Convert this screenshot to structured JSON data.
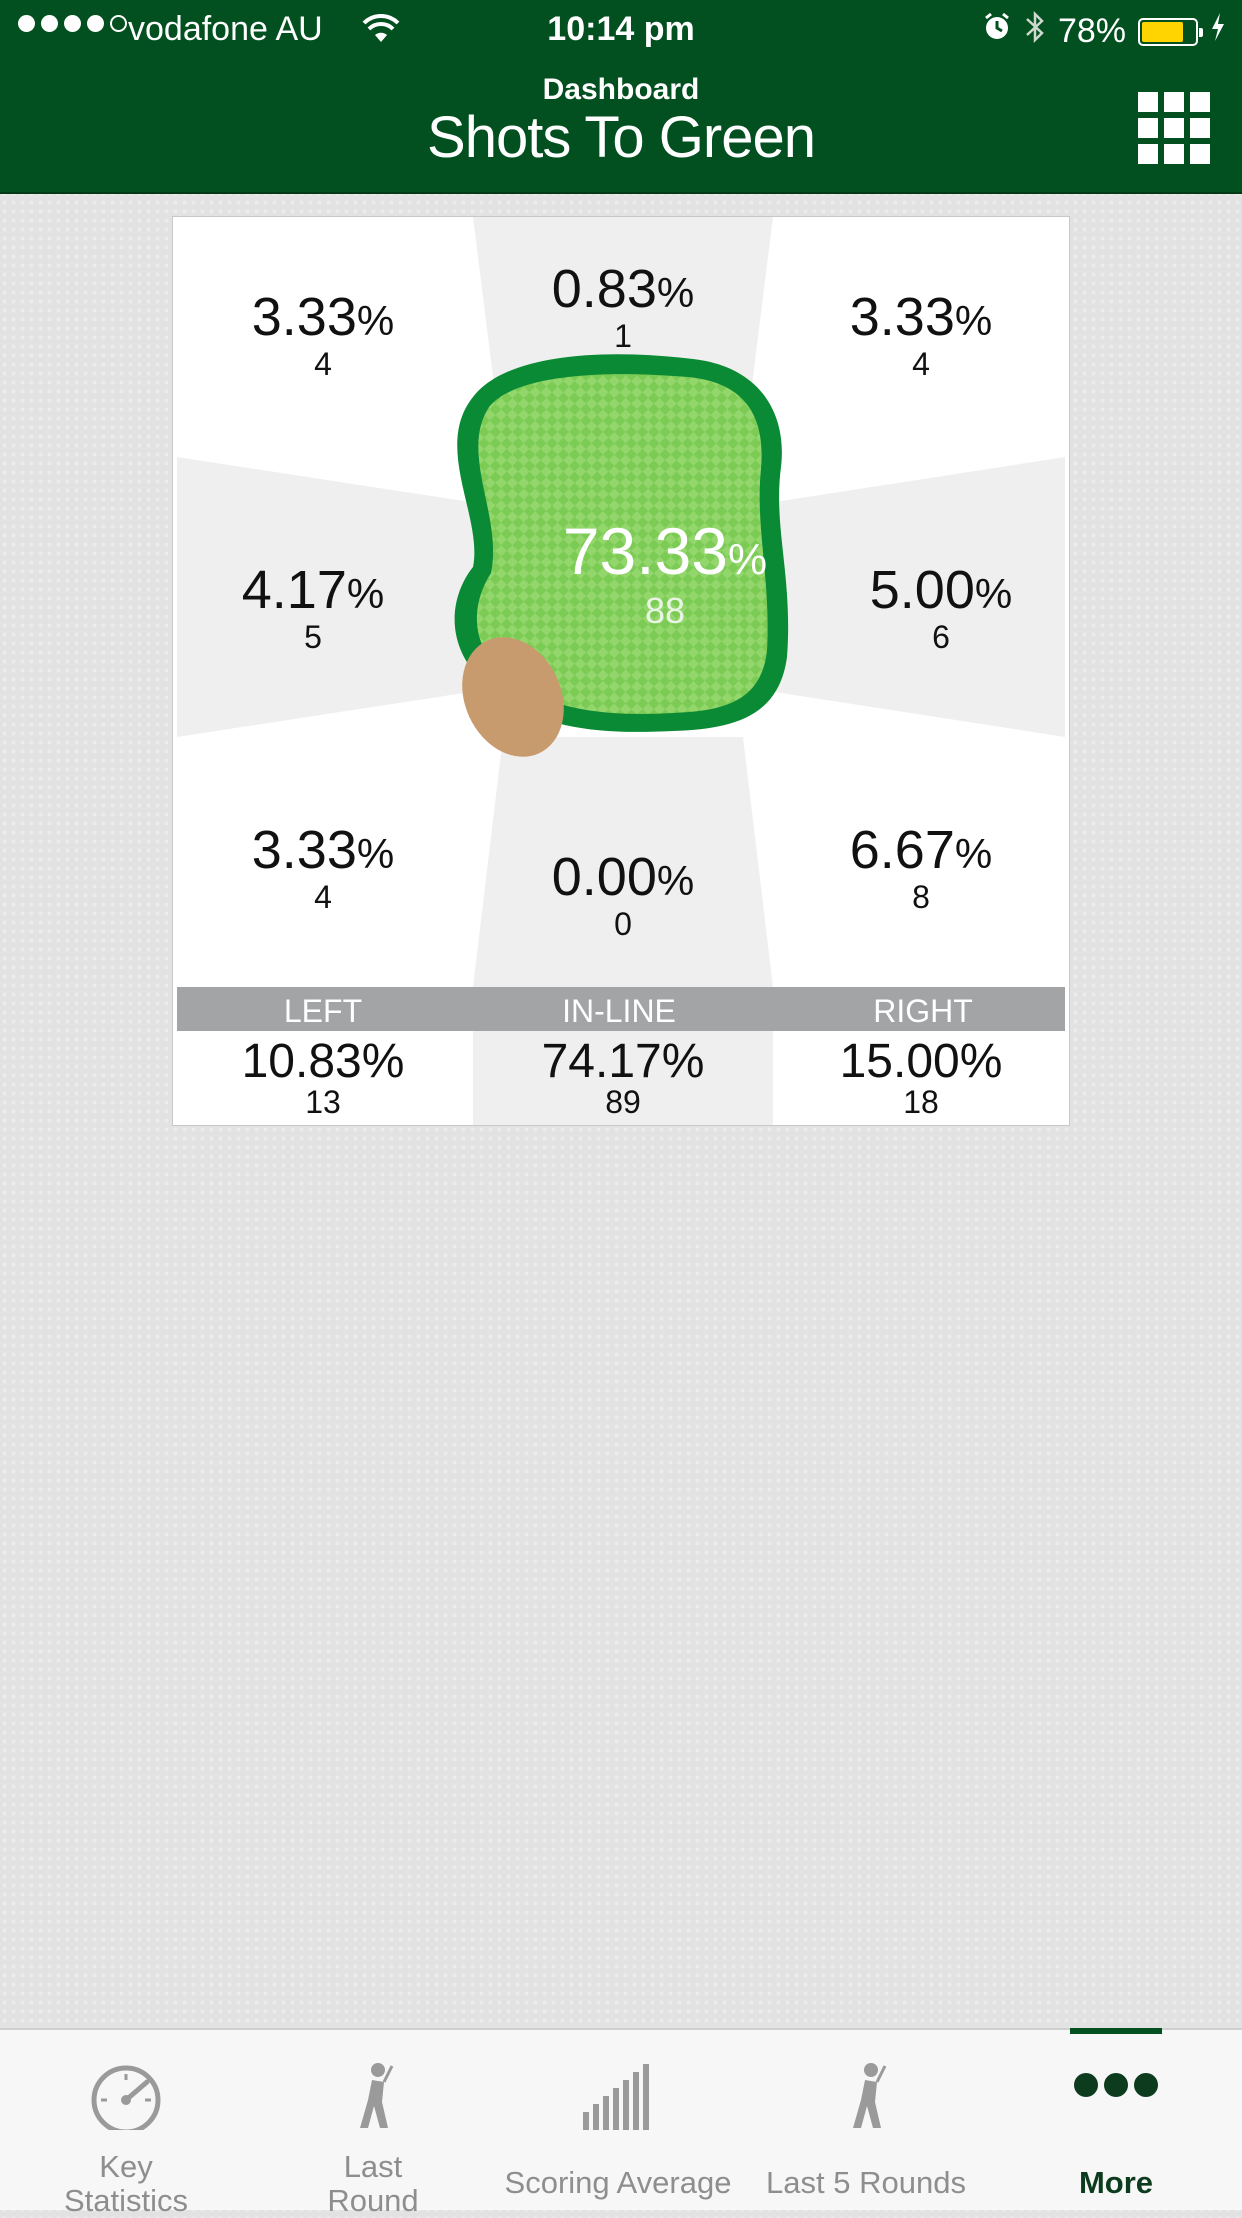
{
  "status_bar": {
    "carrier": "vodafone AU",
    "time": "10:14 pm",
    "battery_text": "78%",
    "battery_level": 0.78,
    "signal_bars_filled": 4,
    "signal_bars_total": 5
  },
  "header": {
    "subtitle": "Dashboard",
    "title": "Shots To Green",
    "menu_icon": "grid-icon"
  },
  "shot_grid": {
    "top_left": {
      "pct": "3.33",
      "unit": "%",
      "count": "4"
    },
    "top_center": {
      "pct": "0.83",
      "unit": "%",
      "count": "1"
    },
    "top_right": {
      "pct": "3.33",
      "unit": "%",
      "count": "4"
    },
    "mid_left": {
      "pct": "4.17",
      "unit": "%",
      "count": "5"
    },
    "center": {
      "pct": "73.33",
      "unit": "%",
      "count": "88"
    },
    "mid_right": {
      "pct": "5.00",
      "unit": "%",
      "count": "6"
    },
    "bottom_left": {
      "pct": "3.33",
      "unit": "%",
      "count": "4"
    },
    "bottom_center": {
      "pct": "0.00",
      "unit": "%",
      "count": "0"
    },
    "bottom_right": {
      "pct": "6.67",
      "unit": "%",
      "count": "8"
    }
  },
  "columns": {
    "left": {
      "label": "LEFT",
      "pct": "10.83%",
      "count": "13"
    },
    "inline": {
      "label": "IN-LINE",
      "pct": "74.17%",
      "count": "89"
    },
    "right": {
      "label": "RIGHT",
      "pct": "15.00%",
      "count": "18"
    }
  },
  "tabs": [
    {
      "label": "Key Statistics",
      "icon": "speedometer-icon"
    },
    {
      "label": "Last Round",
      "icon": "golfer-icon"
    },
    {
      "label": "Scoring Average",
      "icon": "bar-chart-icon"
    },
    {
      "label": "Last 5 Rounds",
      "icon": "golfer-icon"
    },
    {
      "label": "More",
      "icon": "more-dots-icon",
      "active": true
    }
  ],
  "colors": {
    "header_green": "#024f1f",
    "green_outline": "#0a8a34",
    "green_fill": "#7ccb55",
    "bunker": "#c79b6e",
    "battery": "#ffd400"
  }
}
